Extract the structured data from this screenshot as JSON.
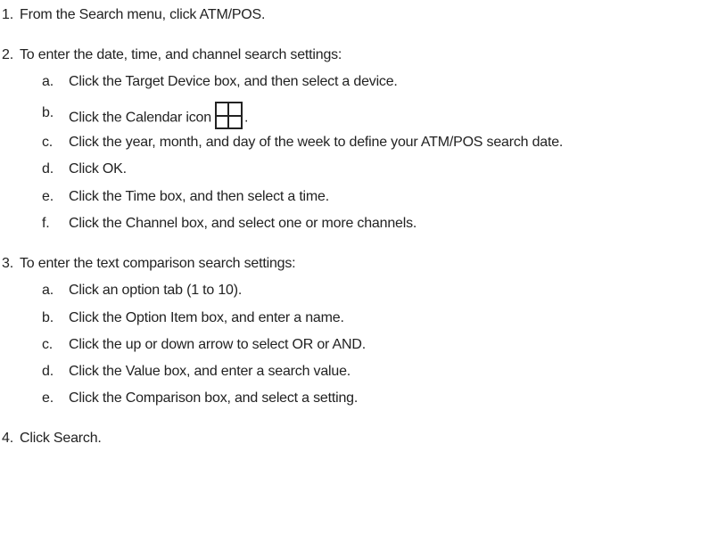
{
  "steps": [
    {
      "number": "1.",
      "text": "From the Search menu, click ATM/POS."
    },
    {
      "number": "2.",
      "text": "To enter the date, time, and channel search settings:",
      "substeps": [
        {
          "mark": "a.",
          "text": "Click the Target Device box, and then select a device."
        },
        {
          "mark": "b.",
          "text": "Click the Calendar icon",
          "text_after_icon": ".",
          "icon": "calendar-grid-icon"
        },
        {
          "mark": "c.",
          "text": "Click the year, month, and day of the week to define your ATM/POS search date."
        },
        {
          "mark": "d.",
          "text": "Click OK."
        },
        {
          "mark": "e.",
          "text": "Click the Time box, and then select a time."
        },
        {
          "mark": "f.",
          "text": "Click the Channel box, and select one or more channels."
        }
      ]
    },
    {
      "number": "3.",
      "text": "To enter the text comparison search settings:",
      "substeps": [
        {
          "mark": "a.",
          "text": "Click an option tab (1 to 10)."
        },
        {
          "mark": "b.",
          "text": "Click the Option Item box, and enter a name."
        },
        {
          "mark": "c.",
          "text": "Click the up or down arrow to select OR or AND."
        },
        {
          "mark": "d.",
          "text": "Click the Value box, and enter a search value."
        },
        {
          "mark": "e.",
          "text": "Click the Comparison box, and select a setting."
        }
      ]
    },
    {
      "number": "4.",
      "text": "Click Search."
    }
  ]
}
